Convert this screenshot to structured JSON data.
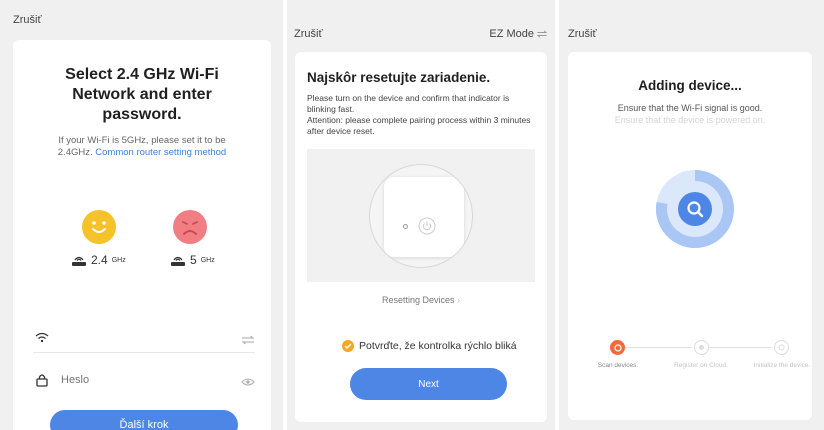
{
  "panel1": {
    "cancel_label": "Zrušiť",
    "title": "Select 2.4 GHz Wi-Fi Network and enter password.",
    "hint_text": "If your Wi-Fi is 5GHz, please set it to be 2.4GHz.",
    "hint_link": "Common router setting method",
    "band_24": {
      "value": "2.4",
      "unit": "GHz"
    },
    "band_5": {
      "value": "5",
      "unit": "GHz"
    },
    "wifi_field": {
      "value": ""
    },
    "password_field": {
      "placeholder": "Heslo"
    },
    "next_label": "Ďalší krok",
    "accent": "#4e86e6",
    "happy_color": "#f5c22a",
    "sad_color": "#f17e83"
  },
  "panel2": {
    "cancel_label": "Zrušiť",
    "ez_mode_label": "EZ Mode",
    "title": "Najskôr resetujte zariadenie.",
    "desc_line1": "Please turn on the device and confirm that indicator is blinking fast.",
    "desc_line2": "Attention: please complete pairing process within 3 minutes after device reset.",
    "resetting_link": "Resetting Devices",
    "confirm_text": "Potvrďte, že kontrolka rýchlo bliká",
    "next_label": "Next",
    "check_color": "#f5a623"
  },
  "panel3": {
    "cancel_label": "Zrušiť",
    "title": "Adding device...",
    "subtitle": "Ensure that the Wi-Fi signal is good.",
    "subtitle_faint": "Ensure that the device is powered on.",
    "steps": [
      {
        "label": "Scan devices.",
        "status": "active"
      },
      {
        "label": "Register on Cloud.",
        "status": "pending"
      },
      {
        "label": "Initialize the device.",
        "status": "pending"
      }
    ],
    "active_color": "#f06a3c",
    "ring_color": "#4e86e6"
  }
}
